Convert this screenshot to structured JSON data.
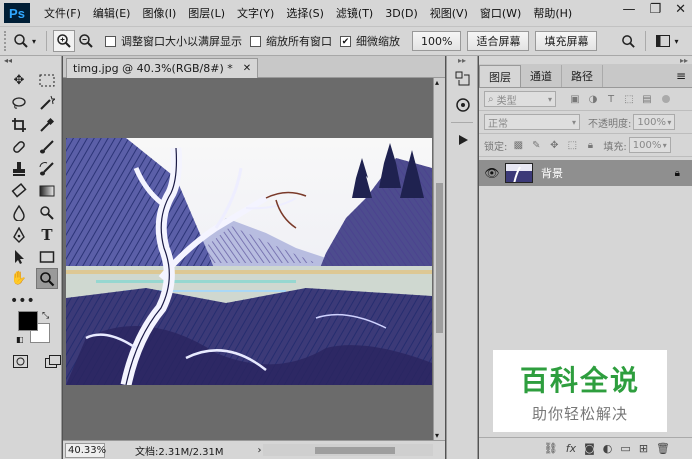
{
  "app": {
    "logo": "Ps"
  },
  "menu": [
    "文件(F)",
    "编辑(E)",
    "图像(I)",
    "图层(L)",
    "文字(Y)",
    "选择(S)",
    "滤镜(T)",
    "3D(D)",
    "视图(V)",
    "窗口(W)",
    "帮助(H)"
  ],
  "window_controls": {
    "minimize": "—",
    "restore": "❐",
    "close": "✕"
  },
  "options": {
    "resize_windows": "调整窗口大小以满屏显示",
    "resize_checked": false,
    "zoom_all": "缩放所有窗口",
    "zoom_all_checked": false,
    "scrubby_zoom": "细微缩放",
    "scrubby_checked": true,
    "btn_100": "100%",
    "btn_fit": "适合屏幕",
    "btn_fill": "填充屏幕"
  },
  "document": {
    "tab_title": "timg.jpg @ 40.3%(RGB/8#) *",
    "zoom": "40.33%",
    "doc_size": "文档:2.31M/2.31M"
  },
  "layers_panel": {
    "tabs": [
      "图层",
      "通道",
      "路径"
    ],
    "kind_filter": "类型",
    "blend_mode": "正常",
    "opacity_label": "不透明度:",
    "opacity_value": "100%",
    "lock_label": "锁定:",
    "fill_label": "填充:",
    "fill_value": "100%",
    "layers": [
      {
        "name": "背景",
        "visible": true,
        "locked": true
      }
    ]
  },
  "watermark": {
    "title": "百科全说",
    "subtitle": "助你轻松解决"
  }
}
